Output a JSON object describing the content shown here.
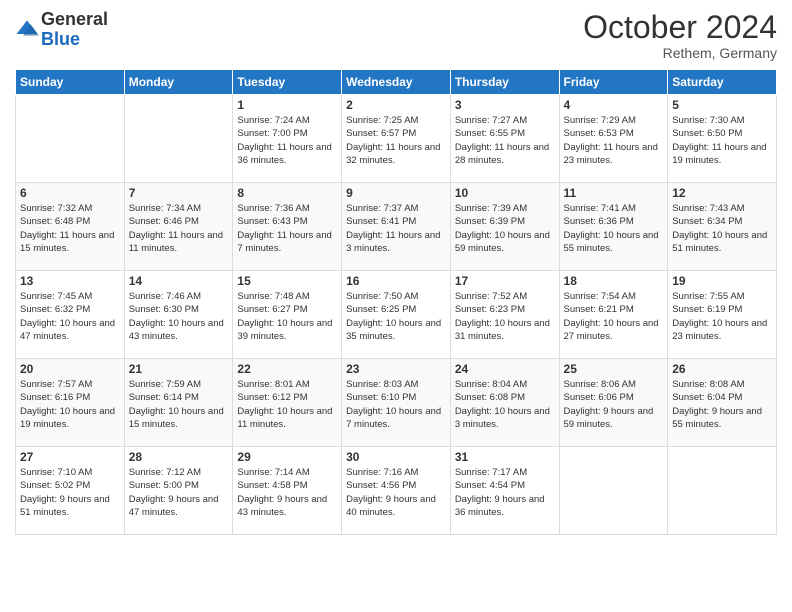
{
  "header": {
    "logo_general": "General",
    "logo_blue": "Blue",
    "month": "October 2024",
    "location": "Rethem, Germany"
  },
  "days_of_week": [
    "Sunday",
    "Monday",
    "Tuesday",
    "Wednesday",
    "Thursday",
    "Friday",
    "Saturday"
  ],
  "weeks": [
    [
      {
        "day": "",
        "info": ""
      },
      {
        "day": "",
        "info": ""
      },
      {
        "day": "1",
        "info": "Sunrise: 7:24 AM\nSunset: 7:00 PM\nDaylight: 11 hours and 36 minutes."
      },
      {
        "day": "2",
        "info": "Sunrise: 7:25 AM\nSunset: 6:57 PM\nDaylight: 11 hours and 32 minutes."
      },
      {
        "day": "3",
        "info": "Sunrise: 7:27 AM\nSunset: 6:55 PM\nDaylight: 11 hours and 28 minutes."
      },
      {
        "day": "4",
        "info": "Sunrise: 7:29 AM\nSunset: 6:53 PM\nDaylight: 11 hours and 23 minutes."
      },
      {
        "day": "5",
        "info": "Sunrise: 7:30 AM\nSunset: 6:50 PM\nDaylight: 11 hours and 19 minutes."
      }
    ],
    [
      {
        "day": "6",
        "info": "Sunrise: 7:32 AM\nSunset: 6:48 PM\nDaylight: 11 hours and 15 minutes."
      },
      {
        "day": "7",
        "info": "Sunrise: 7:34 AM\nSunset: 6:46 PM\nDaylight: 11 hours and 11 minutes."
      },
      {
        "day": "8",
        "info": "Sunrise: 7:36 AM\nSunset: 6:43 PM\nDaylight: 11 hours and 7 minutes."
      },
      {
        "day": "9",
        "info": "Sunrise: 7:37 AM\nSunset: 6:41 PM\nDaylight: 11 hours and 3 minutes."
      },
      {
        "day": "10",
        "info": "Sunrise: 7:39 AM\nSunset: 6:39 PM\nDaylight: 10 hours and 59 minutes."
      },
      {
        "day": "11",
        "info": "Sunrise: 7:41 AM\nSunset: 6:36 PM\nDaylight: 10 hours and 55 minutes."
      },
      {
        "day": "12",
        "info": "Sunrise: 7:43 AM\nSunset: 6:34 PM\nDaylight: 10 hours and 51 minutes."
      }
    ],
    [
      {
        "day": "13",
        "info": "Sunrise: 7:45 AM\nSunset: 6:32 PM\nDaylight: 10 hours and 47 minutes."
      },
      {
        "day": "14",
        "info": "Sunrise: 7:46 AM\nSunset: 6:30 PM\nDaylight: 10 hours and 43 minutes."
      },
      {
        "day": "15",
        "info": "Sunrise: 7:48 AM\nSunset: 6:27 PM\nDaylight: 10 hours and 39 minutes."
      },
      {
        "day": "16",
        "info": "Sunrise: 7:50 AM\nSunset: 6:25 PM\nDaylight: 10 hours and 35 minutes."
      },
      {
        "day": "17",
        "info": "Sunrise: 7:52 AM\nSunset: 6:23 PM\nDaylight: 10 hours and 31 minutes."
      },
      {
        "day": "18",
        "info": "Sunrise: 7:54 AM\nSunset: 6:21 PM\nDaylight: 10 hours and 27 minutes."
      },
      {
        "day": "19",
        "info": "Sunrise: 7:55 AM\nSunset: 6:19 PM\nDaylight: 10 hours and 23 minutes."
      }
    ],
    [
      {
        "day": "20",
        "info": "Sunrise: 7:57 AM\nSunset: 6:16 PM\nDaylight: 10 hours and 19 minutes."
      },
      {
        "day": "21",
        "info": "Sunrise: 7:59 AM\nSunset: 6:14 PM\nDaylight: 10 hours and 15 minutes."
      },
      {
        "day": "22",
        "info": "Sunrise: 8:01 AM\nSunset: 6:12 PM\nDaylight: 10 hours and 11 minutes."
      },
      {
        "day": "23",
        "info": "Sunrise: 8:03 AM\nSunset: 6:10 PM\nDaylight: 10 hours and 7 minutes."
      },
      {
        "day": "24",
        "info": "Sunrise: 8:04 AM\nSunset: 6:08 PM\nDaylight: 10 hours and 3 minutes."
      },
      {
        "day": "25",
        "info": "Sunrise: 8:06 AM\nSunset: 6:06 PM\nDaylight: 9 hours and 59 minutes."
      },
      {
        "day": "26",
        "info": "Sunrise: 8:08 AM\nSunset: 6:04 PM\nDaylight: 9 hours and 55 minutes."
      }
    ],
    [
      {
        "day": "27",
        "info": "Sunrise: 7:10 AM\nSunset: 5:02 PM\nDaylight: 9 hours and 51 minutes."
      },
      {
        "day": "28",
        "info": "Sunrise: 7:12 AM\nSunset: 5:00 PM\nDaylight: 9 hours and 47 minutes."
      },
      {
        "day": "29",
        "info": "Sunrise: 7:14 AM\nSunset: 4:58 PM\nDaylight: 9 hours and 43 minutes."
      },
      {
        "day": "30",
        "info": "Sunrise: 7:16 AM\nSunset: 4:56 PM\nDaylight: 9 hours and 40 minutes."
      },
      {
        "day": "31",
        "info": "Sunrise: 7:17 AM\nSunset: 4:54 PM\nDaylight: 9 hours and 36 minutes."
      },
      {
        "day": "",
        "info": ""
      },
      {
        "day": "",
        "info": ""
      }
    ]
  ]
}
